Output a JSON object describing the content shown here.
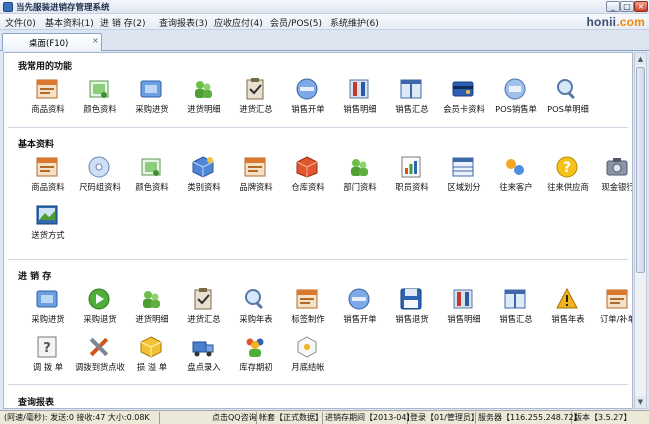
{
  "window": {
    "title": "当先服装进销存管理系统",
    "brand_pre": "honii",
    "brand_post": ".com"
  },
  "menu": [
    {
      "label": "文件(0)"
    },
    {
      "label": "基本资料(1)"
    },
    {
      "label": "进 销 存(2)"
    },
    {
      "label": "查询报表(3)"
    },
    {
      "label": "应收应付(4)"
    },
    {
      "label": "会员/POS(5)"
    },
    {
      "label": "系统维护(6)"
    }
  ],
  "tabs": [
    {
      "label": "桌面(F10)",
      "close": "×"
    }
  ],
  "sections": [
    {
      "title": "我常用的功能",
      "items": [
        {
          "label": "商品资料",
          "icon": "product-icon"
        },
        {
          "label": "颜色资料",
          "icon": "color-icon"
        },
        {
          "label": "采购进货",
          "icon": "purchase-icon"
        },
        {
          "label": "进货明细",
          "icon": "people-icon"
        },
        {
          "label": "进货汇总",
          "icon": "clipboard-icon"
        },
        {
          "label": "销售开单",
          "icon": "circle-icon"
        },
        {
          "label": "销售明细",
          "icon": "tools-icon"
        },
        {
          "label": "销售汇总",
          "icon": "window-icon"
        },
        {
          "label": "会员卡资料",
          "icon": "card-icon"
        },
        {
          "label": "POS销售单",
          "icon": "pos-icon"
        },
        {
          "label": "POS单明细",
          "icon": "magnifier-icon"
        }
      ]
    },
    {
      "title": "基本资料",
      "items": [
        {
          "label": "商品资料",
          "icon": "product-icon"
        },
        {
          "label": "尺码组资料",
          "icon": "disc-icon"
        },
        {
          "label": "颜色资料",
          "icon": "color-icon"
        },
        {
          "label": "类别资料",
          "icon": "cube-icon"
        },
        {
          "label": "品牌资料",
          "icon": "product-icon"
        },
        {
          "label": "仓库资料",
          "icon": "warehouse-icon"
        },
        {
          "label": "部门资料",
          "icon": "people-icon"
        },
        {
          "label": "职员资料",
          "icon": "chart-icon"
        },
        {
          "label": "区域划分",
          "icon": "grid-icon"
        },
        {
          "label": "往来客户",
          "icon": "dots-icon"
        },
        {
          "label": "往来供应商",
          "icon": "question-icon"
        },
        {
          "label": "现金银行",
          "icon": "camera-icon"
        },
        {
          "label": "送货方式",
          "icon": "picture-icon"
        }
      ]
    },
    {
      "title": "进 销 存",
      "items": [
        {
          "label": "采购进货",
          "icon": "purchase-icon"
        },
        {
          "label": "采购退货",
          "icon": "play-icon"
        },
        {
          "label": "进货明细",
          "icon": "people-icon"
        },
        {
          "label": "进货汇总",
          "icon": "clipboard-icon"
        },
        {
          "label": "采购年表",
          "icon": "magnifier-icon"
        },
        {
          "label": "标签制作",
          "icon": "product-icon"
        },
        {
          "label": "销售开单",
          "icon": "circle-icon"
        },
        {
          "label": "销售退货",
          "icon": "floppy-icon"
        },
        {
          "label": "销售明细",
          "icon": "tools-icon"
        },
        {
          "label": "销售汇总",
          "icon": "window-icon"
        },
        {
          "label": "销售年表",
          "icon": "warning-icon"
        },
        {
          "label": "订单/补单",
          "icon": "product-icon"
        },
        {
          "label": "调 拨 单",
          "icon": "help-icon"
        },
        {
          "label": "调拨到货点收",
          "icon": "wrench-icon"
        },
        {
          "label": "损 溢 单",
          "icon": "cube-yellow-icon"
        },
        {
          "label": "盘点录入",
          "icon": "truck-icon"
        },
        {
          "label": "库存期初",
          "icon": "group-icon"
        },
        {
          "label": "月底结帐",
          "icon": "hexagon-icon"
        }
      ]
    },
    {
      "title": "查询报表",
      "items": []
    }
  ],
  "status": [
    "(阿速/毫秒): 发送:0 接收:47 大小:0.08K",
    "点击QQ咨询",
    "帐套【正式数据】",
    "进销存期间【2013-04】",
    "登录【01/管理员】",
    "服务器【116.255.248.72】",
    "版本【3.5.27】"
  ],
  "colors": {
    "accent": "#3a6fb8",
    "brand_orange": "#f08a00"
  }
}
